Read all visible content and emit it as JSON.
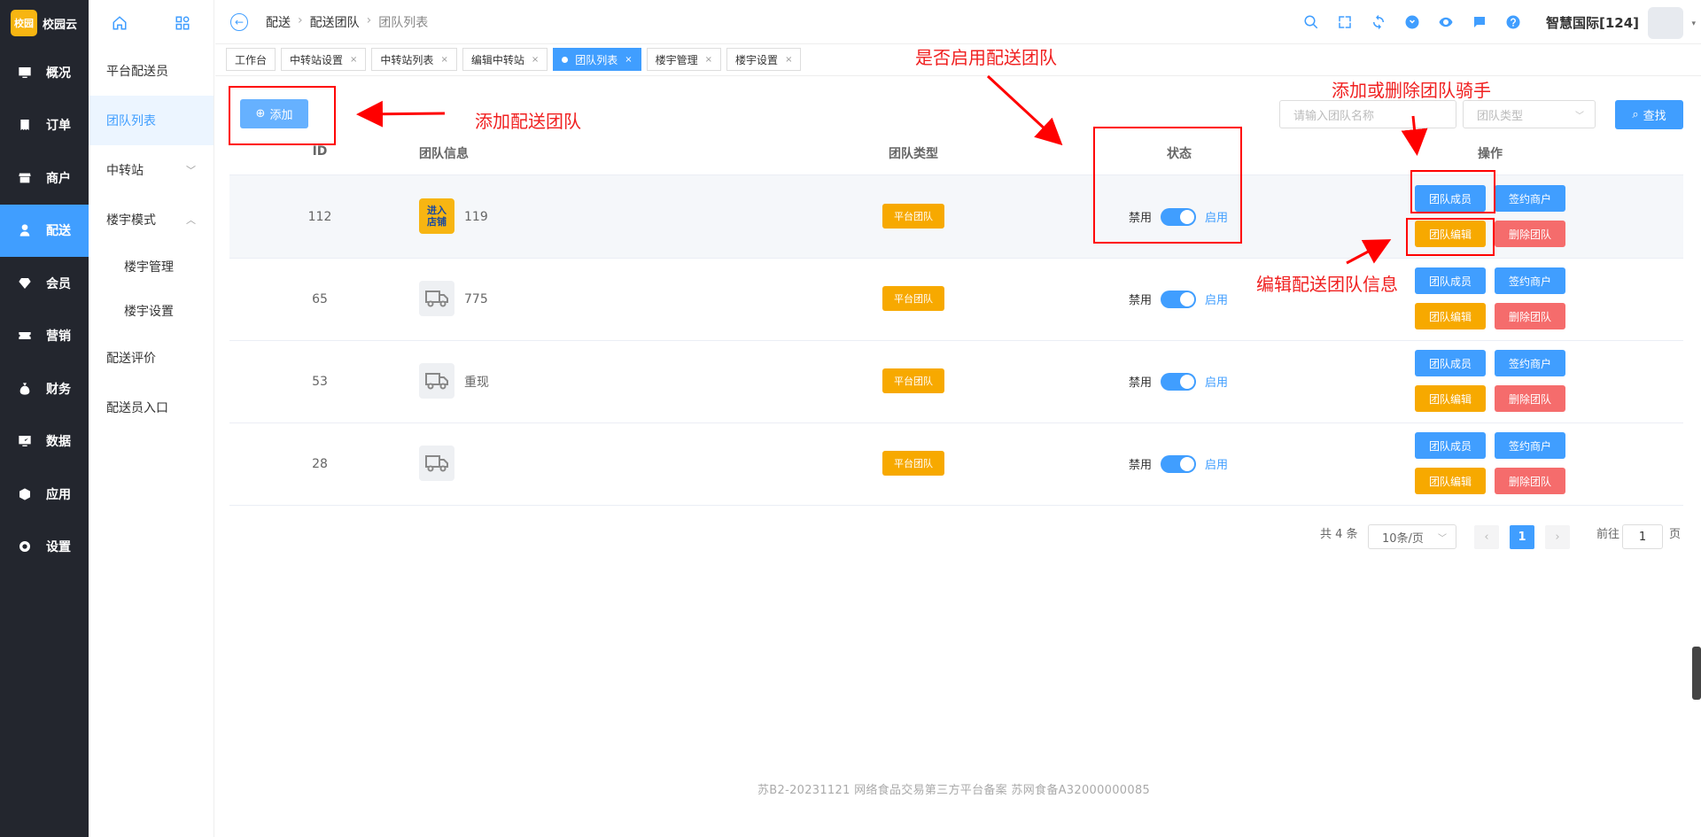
{
  "app": {
    "logo_badge": "校园",
    "logo_text": "校园云"
  },
  "sidebar": {
    "items": [
      {
        "label": "概况",
        "icon": "monitor-icon"
      },
      {
        "label": "订单",
        "icon": "order-icon"
      },
      {
        "label": "商户",
        "icon": "store-icon"
      },
      {
        "label": "配送",
        "icon": "delivery-user-icon"
      },
      {
        "label": "会员",
        "icon": "diamond-icon"
      },
      {
        "label": "营销",
        "icon": "ticket-icon"
      },
      {
        "label": "财务",
        "icon": "money-bag-icon"
      },
      {
        "label": "数据",
        "icon": "chart-monitor-icon"
      },
      {
        "label": "应用",
        "icon": "cube-icon"
      },
      {
        "label": "设置",
        "icon": "gear-icon"
      }
    ],
    "active_index": 3
  },
  "submenu": {
    "items": [
      {
        "label": "平台配送员"
      },
      {
        "label": "团队列表"
      },
      {
        "label": "中转站"
      },
      {
        "label": "楼宇模式"
      },
      {
        "label": "楼宇管理"
      },
      {
        "label": "楼宇设置"
      },
      {
        "label": "配送评价"
      },
      {
        "label": "配送员入口"
      }
    ]
  },
  "header": {
    "breadcrumb": [
      "配送",
      "配送团队",
      "团队列表"
    ],
    "user": "智慧国际[124]"
  },
  "tabs": [
    {
      "label": "工作台"
    },
    {
      "label": "中转站设置"
    },
    {
      "label": "中转站列表"
    },
    {
      "label": "编辑中转站"
    },
    {
      "label": "团队列表"
    },
    {
      "label": "楼宇管理"
    },
    {
      "label": "楼宇设置"
    }
  ],
  "toolbar": {
    "add_label": "添加",
    "search_placeholder": "请输入团队名称",
    "type_placeholder": "团队类型",
    "find_label": "查找"
  },
  "table": {
    "headers": {
      "id": "ID",
      "info": "团队信息",
      "type": "团队类型",
      "status": "状态",
      "ops": "操作"
    },
    "rows": [
      {
        "id": "112",
        "name": "119",
        "image": "store-sign",
        "image_text": "进入店铺",
        "type": "平台团队",
        "off": "禁用",
        "on": "启用",
        "enabled": true
      },
      {
        "id": "65",
        "name": "775",
        "image": "truck-icon",
        "image_text": "",
        "type": "平台团队",
        "off": "禁用",
        "on": "启用",
        "enabled": true
      },
      {
        "id": "53",
        "name": "重现",
        "image": "truck-icon",
        "image_text": "",
        "type": "平台团队",
        "off": "禁用",
        "on": "启用",
        "enabled": true
      },
      {
        "id": "28",
        "name": "",
        "image": "truck-icon",
        "image_text": "",
        "type": "平台团队",
        "off": "禁用",
        "on": "启用",
        "enabled": true
      }
    ],
    "actions": {
      "members": "团队成员",
      "sign": "签约商户",
      "edit": "团队编辑",
      "delete": "删除团队"
    }
  },
  "pagination": {
    "total": "共 4 条",
    "page_size": "10条/页",
    "current": "1",
    "goto": "前往",
    "goto_value": "1",
    "page_unit": "页"
  },
  "footer": "苏B2-20231121  网络食品交易第三方平台备案 苏网食备A32000000085",
  "annotations": {
    "add": "添加配送团队",
    "enable": "是否启用配送团队",
    "members": "添加或删除团队骑手",
    "edit": "编辑配送团队信息"
  },
  "colors": {
    "primary": "#409eff",
    "warning": "#f7a900",
    "danger": "#f56c6c",
    "sidebar": "#23262e",
    "annotation": "#ff0000"
  }
}
